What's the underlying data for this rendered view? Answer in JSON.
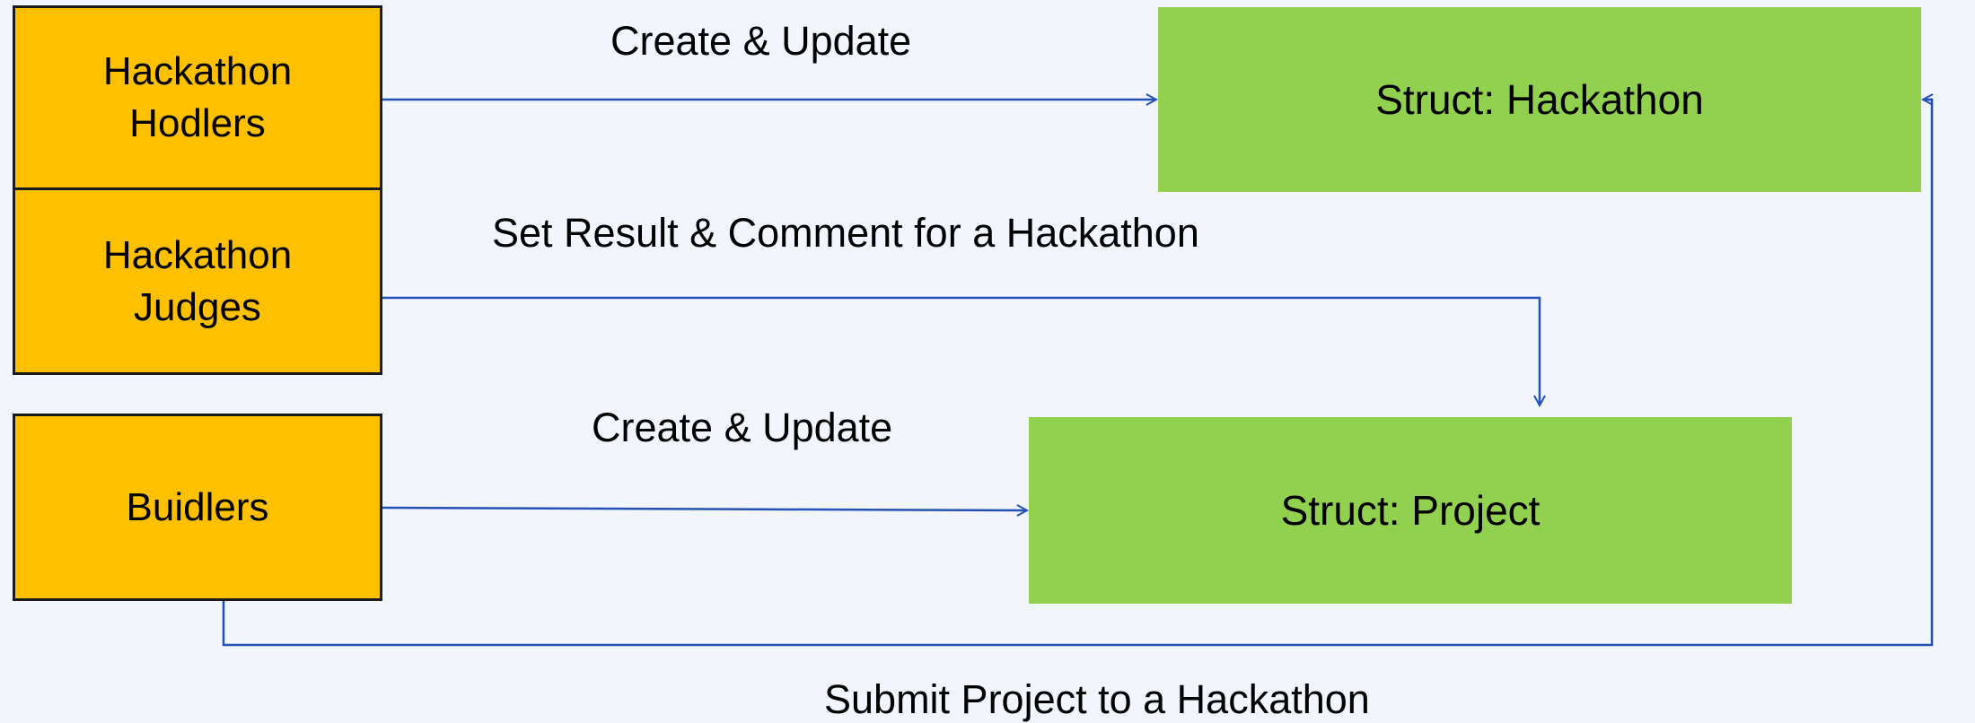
{
  "colors": {
    "background": "#f2f5fc",
    "actor_fill": "#ffc000",
    "actor_border": "#1a1a1a",
    "struct_fill": "#92d050",
    "arrow": "#2451b5"
  },
  "actors": {
    "holders": "Hackathon\nHodlers",
    "judges": "Hackathon\nJudges",
    "builders": "Buidlers"
  },
  "structs": {
    "hackathon": "Struct: Hackathon",
    "project": "Struct: Project"
  },
  "edges": {
    "holders_to_hackathon": "Create & Update",
    "judges_to_project": "Set Result & Comment for a Hackathon",
    "builders_to_project": "Create & Update",
    "builders_to_hackathon": "Submit Project to a Hackathon"
  }
}
